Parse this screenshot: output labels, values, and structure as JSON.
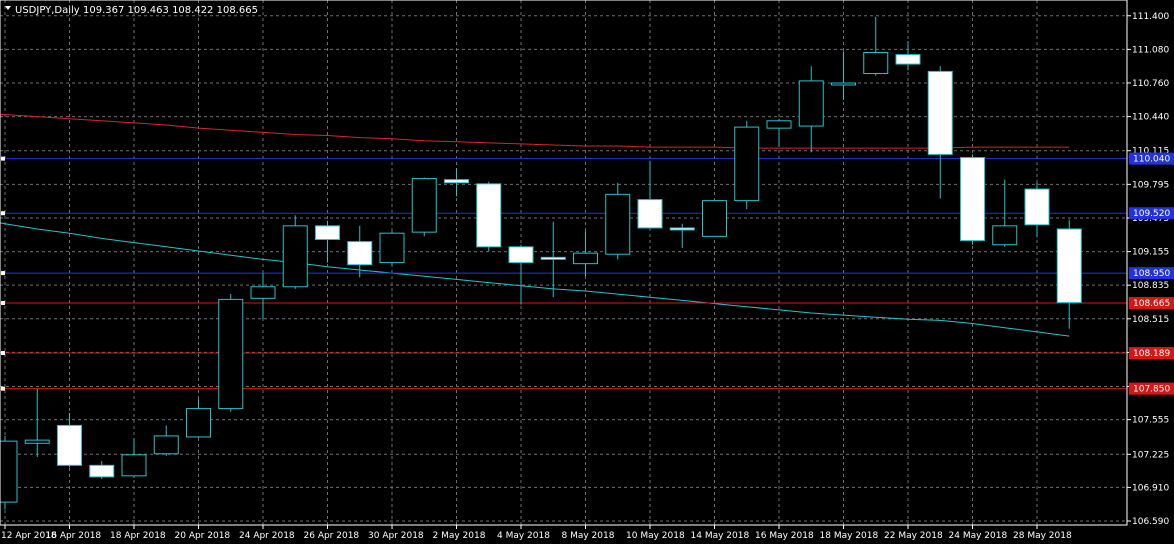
{
  "header": {
    "symbol": "USDJPY,Daily",
    "ohlc": "109.367 109.463 108.422 108.665"
  },
  "colors": {
    "background": "#000000",
    "grid": "#6e6e6e",
    "axis": "#ffffff",
    "candle_up_fill": "#000000",
    "candle_down_fill": "#ffffff",
    "candle_stroke": "#2ac1c9",
    "ma_slow": "#d4262a",
    "ma_fast": "#2ac1c9",
    "support_line": "#2233dd",
    "resistance_line": "#d41818",
    "support_label_bg": "#2233dd",
    "resistance_label_bg": "#d41818"
  },
  "chart_data": {
    "type": "candlestick",
    "title": "USDJPY,Daily",
    "ylim": [
      106.59,
      111.55
    ],
    "y_ticks": [
      "111.400",
      "111.080",
      "110.760",
      "110.440",
      "110.115",
      "109.795",
      "109.475",
      "109.155",
      "108.835",
      "108.515",
      "108.195",
      "107.870",
      "107.555",
      "107.225",
      "106.910",
      "106.590"
    ],
    "x_ticks": [
      "12 Apr 2018",
      "16 Apr 2018",
      "18 Apr 2018",
      "20 Apr 2018",
      "24 Apr 2018",
      "26 Apr 2018",
      "30 Apr 2018",
      "2 May 2018",
      "4 May 2018",
      "8 May 2018",
      "10 May 2018",
      "14 May 2018",
      "16 May 2018",
      "18 May 2018",
      "22 May 2018",
      "24 May 2018",
      "28 May 2018"
    ],
    "grid": true,
    "candles": [
      {
        "date": "12 Apr 2018",
        "open": 106.77,
        "high": 107.4,
        "low": 106.7,
        "close": 107.35
      },
      {
        "date": "13 Apr 2018",
        "open": 107.33,
        "high": 107.85,
        "low": 107.2,
        "close": 107.36
      },
      {
        "date": "16 Apr 2018",
        "open": 107.5,
        "high": 107.62,
        "low": 107.1,
        "close": 107.12
      },
      {
        "date": "17 Apr 2018",
        "open": 107.12,
        "high": 107.16,
        "low": 106.99,
        "close": 107.01
      },
      {
        "date": "18 Apr 2018",
        "open": 107.02,
        "high": 107.38,
        "low": 107.0,
        "close": 107.22
      },
      {
        "date": "19 Apr 2018",
        "open": 107.23,
        "high": 107.5,
        "low": 107.21,
        "close": 107.4
      },
      {
        "date": "20 Apr 2018",
        "open": 107.39,
        "high": 107.75,
        "low": 107.38,
        "close": 107.66
      },
      {
        "date": "23 Apr 2018",
        "open": 107.66,
        "high": 108.75,
        "low": 107.63,
        "close": 108.7
      },
      {
        "date": "24 Apr 2018",
        "open": 108.71,
        "high": 108.95,
        "low": 108.51,
        "close": 108.82
      },
      {
        "date": "25 Apr 2018",
        "open": 108.82,
        "high": 109.5,
        "low": 108.8,
        "close": 109.4
      },
      {
        "date": "26 Apr 2018",
        "open": 109.4,
        "high": 109.45,
        "low": 109.05,
        "close": 109.27
      },
      {
        "date": "27 Apr 2018",
        "open": 109.25,
        "high": 109.4,
        "low": 108.91,
        "close": 109.03
      },
      {
        "date": "30 Apr 2018",
        "open": 109.05,
        "high": 109.35,
        "low": 109.02,
        "close": 109.33
      },
      {
        "date": "1 May 2018",
        "open": 109.34,
        "high": 109.86,
        "low": 109.3,
        "close": 109.85
      },
      {
        "date": "2 May 2018",
        "open": 109.84,
        "high": 109.95,
        "low": 109.68,
        "close": 109.81
      },
      {
        "date": "3 May 2018",
        "open": 109.8,
        "high": 109.82,
        "low": 109.16,
        "close": 109.2
      },
      {
        "date": "4 May 2018",
        "open": 109.2,
        "high": 109.22,
        "low": 108.65,
        "close": 109.05
      },
      {
        "date": "7 May 2018",
        "open": 109.1,
        "high": 109.44,
        "low": 108.72,
        "close": 109.09
      },
      {
        "date": "8 May 2018",
        "open": 109.04,
        "high": 109.35,
        "low": 108.92,
        "close": 109.14
      },
      {
        "date": "9 May 2018",
        "open": 109.13,
        "high": 109.81,
        "low": 109.08,
        "close": 109.7
      },
      {
        "date": "10 May 2018",
        "open": 109.65,
        "high": 110.02,
        "low": 109.38,
        "close": 109.38
      },
      {
        "date": "11 May 2018",
        "open": 109.38,
        "high": 109.42,
        "low": 109.19,
        "close": 109.37
      },
      {
        "date": "14 May 2018",
        "open": 109.3,
        "high": 109.64,
        "low": 109.3,
        "close": 109.64
      },
      {
        "date": "15 May 2018",
        "open": 109.64,
        "high": 110.4,
        "low": 109.56,
        "close": 110.34
      },
      {
        "date": "16 May 2018",
        "open": 110.33,
        "high": 110.42,
        "low": 110.15,
        "close": 110.4
      },
      {
        "date": "17 May 2018",
        "open": 110.35,
        "high": 110.92,
        "low": 110.1,
        "close": 110.78
      },
      {
        "date": "18 May 2018",
        "open": 110.75,
        "high": 111.06,
        "low": 110.6,
        "close": 110.76
      },
      {
        "date": "21 May 2018",
        "open": 110.85,
        "high": 111.39,
        "low": 110.83,
        "close": 111.05
      },
      {
        "date": "22 May 2018",
        "open": 111.03,
        "high": 111.16,
        "low": 110.88,
        "close": 110.94
      },
      {
        "date": "23 May 2018",
        "open": 110.87,
        "high": 110.92,
        "low": 109.66,
        "close": 110.08
      },
      {
        "date": "24 May 2018",
        "open": 110.05,
        "high": 110.08,
        "low": 109.22,
        "close": 109.26
      },
      {
        "date": "25 May 2018",
        "open": 109.22,
        "high": 109.84,
        "low": 109.2,
        "close": 109.4
      },
      {
        "date": "28 May 2018",
        "open": 109.75,
        "high": 109.81,
        "low": 109.29,
        "close": 109.41
      },
      {
        "date": "29 May 2018",
        "open": 109.37,
        "high": 109.46,
        "low": 108.42,
        "close": 108.67
      }
    ],
    "moving_averages": [
      {
        "role": "slow",
        "values": [
          110.46,
          110.44,
          110.42,
          110.4,
          110.38,
          110.36,
          110.33,
          110.31,
          110.29,
          110.27,
          110.26,
          110.24,
          110.23,
          110.21,
          110.2,
          110.19,
          110.18,
          110.17,
          110.16,
          110.16,
          110.15,
          110.15,
          110.15,
          110.14,
          110.14,
          110.14,
          110.14,
          110.14,
          110.14,
          110.14,
          110.15,
          110.15,
          110.15,
          110.15
        ]
      },
      {
        "role": "fast",
        "values": [
          109.42,
          109.37,
          109.33,
          109.28,
          109.24,
          109.2,
          109.16,
          109.12,
          109.08,
          109.05,
          109.01,
          108.98,
          108.95,
          108.92,
          108.89,
          108.86,
          108.83,
          108.8,
          108.78,
          108.75,
          108.72,
          108.69,
          108.66,
          108.63,
          108.6,
          108.57,
          108.55,
          108.53,
          108.51,
          108.5,
          108.47,
          108.43,
          108.39,
          108.35
        ]
      }
    ],
    "levels": [
      {
        "price": 110.04,
        "label": "110.040",
        "kind": "support"
      },
      {
        "price": 109.52,
        "label": "109.520",
        "kind": "support"
      },
      {
        "price": 108.95,
        "label": "108.950",
        "kind": "support"
      },
      {
        "price": 108.665,
        "label": "108.665",
        "kind": "resistance"
      },
      {
        "price": 108.189,
        "label": "108.189",
        "kind": "resistance"
      },
      {
        "price": 107.85,
        "label": "107.850",
        "kind": "resistance"
      }
    ]
  }
}
